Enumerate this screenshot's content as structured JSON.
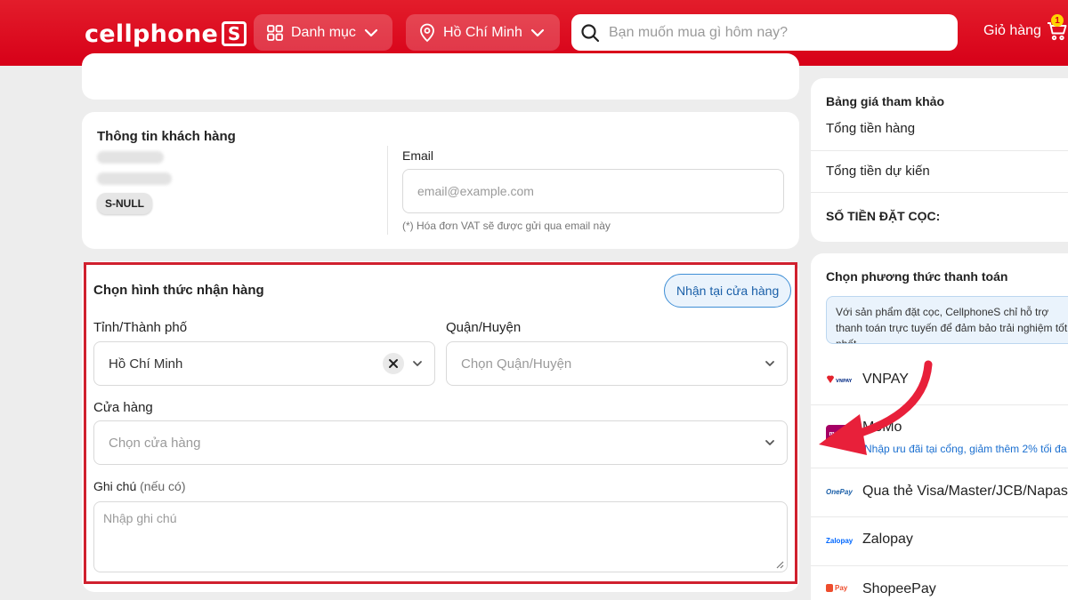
{
  "header": {
    "logo_text": "cellphone",
    "logo_mark": "S",
    "category_label": "Danh mục",
    "location_label": "Hồ Chí Minh",
    "search_placeholder": "Bạn muốn mua gì hôm nay?",
    "cart_label": "Giỏ hàng",
    "cart_count": "1"
  },
  "customer": {
    "title": "Thông tin khách hàng",
    "member_badge": "S-NULL",
    "email_label": "Email",
    "email_placeholder": "email@example.com",
    "email_hint": "(*) Hóa đơn VAT sẽ được gửi qua email này"
  },
  "delivery": {
    "title": "Chọn hình thức nhận hàng",
    "pickup_option": "Nhận tại cửa hàng",
    "province_label": "Tỉnh/Thành phố",
    "province_value": "Hồ Chí Minh",
    "district_label": "Quận/Huyện",
    "district_placeholder": "Chọn Quận/Huyện",
    "store_label": "Cửa hàng",
    "store_placeholder": "Chọn cửa hàng",
    "note_label": "Ghi chú",
    "note_optional": "(nếu có)",
    "note_placeholder": "Nhập ghi chú"
  },
  "price": {
    "title": "Bảng giá tham khảo",
    "total_goods": "Tổng tiền hàng",
    "estimated_total": "Tổng tiền dự kiến",
    "deposit": "SỐ TIỀN ĐẶT CỌC:"
  },
  "payment": {
    "title": "Chọn phương thức thanh toán",
    "notice": "Với sản phẩm đặt cọc, CellphoneS chỉ hỗ trợ thanh toán trực tuyến để đảm bảo trải nghiệm tốt nhất.",
    "methods": [
      {
        "logo": "VNPAY",
        "name": "VNPAY",
        "sub": ""
      },
      {
        "logo": "momo",
        "name": "MoMo",
        "sub": "Nhập ưu đãi tại cổng, giảm thêm 2% tối đa"
      },
      {
        "logo": "OnePay",
        "name": "Qua thẻ Visa/Master/JCB/Napas",
        "sub": ""
      },
      {
        "logo": "Zalopay",
        "name": "Zalopay",
        "sub": ""
      },
      {
        "logo": "Pay",
        "name": "ShopeePay",
        "sub": ""
      }
    ]
  },
  "colors": {
    "brand_red": "#d70018",
    "highlight_frame": "#d0202e",
    "link_blue": "#1a6fd0",
    "arrow": "#e8203a"
  }
}
